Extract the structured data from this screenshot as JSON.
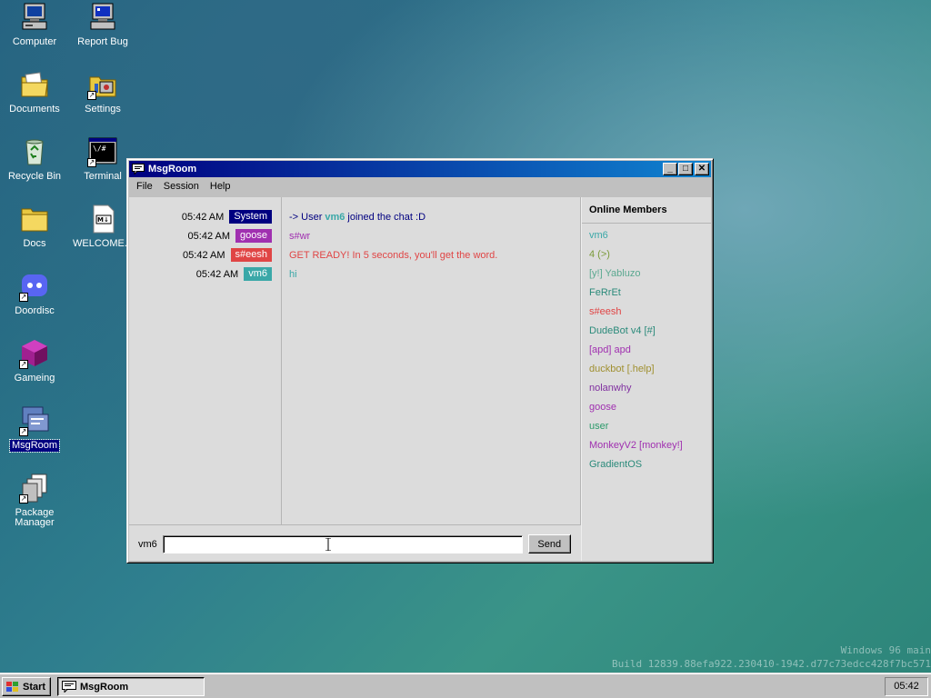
{
  "desktop": {
    "icons": [
      {
        "label": "Computer",
        "icon": "computer-icon"
      },
      {
        "label": "Report Bug",
        "icon": "report-bug-icon"
      },
      {
        "label": "Documents",
        "icon": "documents-folder-icon"
      },
      {
        "label": "Settings",
        "icon": "settings-icon"
      },
      {
        "label": "Recycle Bin",
        "icon": "recycle-bin-icon"
      },
      {
        "label": "Terminal",
        "icon": "terminal-icon"
      },
      {
        "label": "Docs",
        "icon": "docs-folder-icon"
      },
      {
        "label": "WELCOME...",
        "icon": "markdown-file-icon"
      },
      {
        "label": "Doordisc",
        "icon": "doordisc-icon"
      },
      {
        "label": "Gameing",
        "icon": "gameing-cube-icon"
      },
      {
        "label": "MsgRoom",
        "icon": "msgroom-icon"
      },
      {
        "label": "Package Manager",
        "icon": "package-manager-icon"
      }
    ],
    "terminal_icon_text": "\\/#",
    "markdown_icon_text": "M↓"
  },
  "window": {
    "title": "MsgRoom",
    "buttons": {
      "minimize": "_",
      "maximize": "□",
      "close": "✕"
    },
    "menu": [
      "File",
      "Session",
      "Help"
    ]
  },
  "chat": {
    "timestamps": [
      {
        "time": "05:42 AM",
        "user": "System",
        "color": "#000080"
      },
      {
        "time": "05:42 AM",
        "user": "goose",
        "color": "#a030b0"
      },
      {
        "time": "05:42 AM",
        "user": "s#eesh",
        "color": "#e04545"
      },
      {
        "time": "05:42 AM",
        "user": "vm6",
        "color": "#3aa8a8"
      }
    ],
    "messages": [
      {
        "prefix": "-> User",
        "bold": "vm6",
        "suffix": "joined the chat :D",
        "color": "#000080",
        "bold_color": "#3aa8a8"
      },
      {
        "text": "s#wr",
        "color": "#a030b0"
      },
      {
        "text": "GET READY! In 5 seconds, you'll get the word.",
        "color": "#e04545"
      },
      {
        "text": "hi",
        "color": "#3aa8a8"
      }
    ]
  },
  "members": {
    "title": "Online Members",
    "list": [
      {
        "name": "vm6",
        "color": "#3aa8a8"
      },
      {
        "name": "4 (>)",
        "color": "#7a9a3a"
      },
      {
        "name": "[y!] Yabluzo",
        "color": "#5aa890"
      },
      {
        "name": "FeRrEt",
        "color": "#2a8a7a"
      },
      {
        "name": "s#eesh",
        "color": "#e04545"
      },
      {
        "name": "DudeBot v4 [#]",
        "color": "#2a8a7a"
      },
      {
        "name": "[apd] apd",
        "color": "#a030b0"
      },
      {
        "name": "duckbot [.help]",
        "color": "#a09030"
      },
      {
        "name": "nolanwhy",
        "color": "#8030a0"
      },
      {
        "name": "goose",
        "color": "#a030b0"
      },
      {
        "name": "user",
        "color": "#2a9a6a"
      },
      {
        "name": "MonkeyV2 [monkey!]",
        "color": "#a030b0"
      },
      {
        "name": "GradientOS",
        "color": "#2a8a7a"
      }
    ]
  },
  "input": {
    "nick": "vm6",
    "value": "",
    "send_label": "Send"
  },
  "watermark": {
    "line1": "Windows 96 main",
    "line2": "Build 12839.88efa922.230410-1942.d77c73edcc428f7bc571"
  },
  "taskbar": {
    "start_label": "Start",
    "task_label": "MsgRoom",
    "clock": "05:42"
  }
}
